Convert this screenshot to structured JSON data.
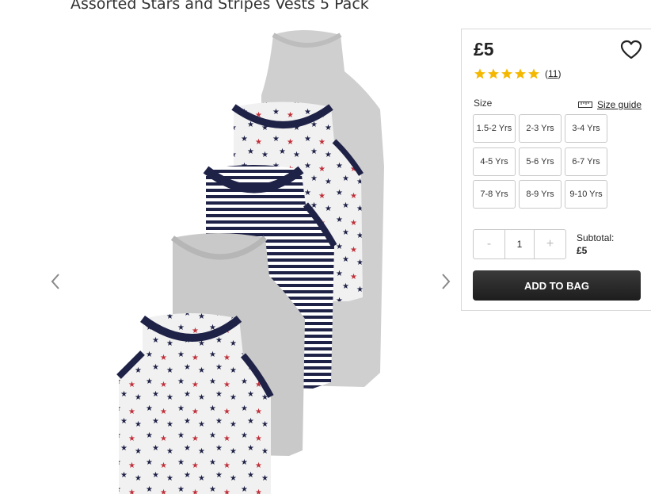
{
  "product": {
    "title": "Assorted Stars and Stripes Vests 5 Pack",
    "price": "£5",
    "rating_value": 5,
    "review_count": "11"
  },
  "icons": {
    "prev": "chevron-left-icon",
    "next": "chevron-right-icon",
    "wishlist": "heart-icon",
    "rating": "star-icon",
    "size_guide": "ruler-icon"
  },
  "sizes": {
    "label": "Size",
    "guide_label": "Size guide",
    "options": [
      "1.5-2 Yrs",
      "2-3 Yrs",
      "3-4 Yrs",
      "4-5 Yrs",
      "5-6 Yrs",
      "6-7 Yrs",
      "7-8 Yrs",
      "8-9 Yrs",
      "9-10 Yrs"
    ]
  },
  "quantity": {
    "decrement": "-",
    "value": "1",
    "increment": "+"
  },
  "subtotal": {
    "label": "Subtotal:",
    "value": "£5"
  },
  "cta": {
    "add_to_bag": "ADD TO BAG"
  },
  "colors": {
    "star_fill": "#f5b800",
    "button_bg": "#2a2a2a",
    "vest_grey": "#c9c9c9",
    "vest_navy": "#1f2247",
    "star_red": "#c0303a"
  }
}
